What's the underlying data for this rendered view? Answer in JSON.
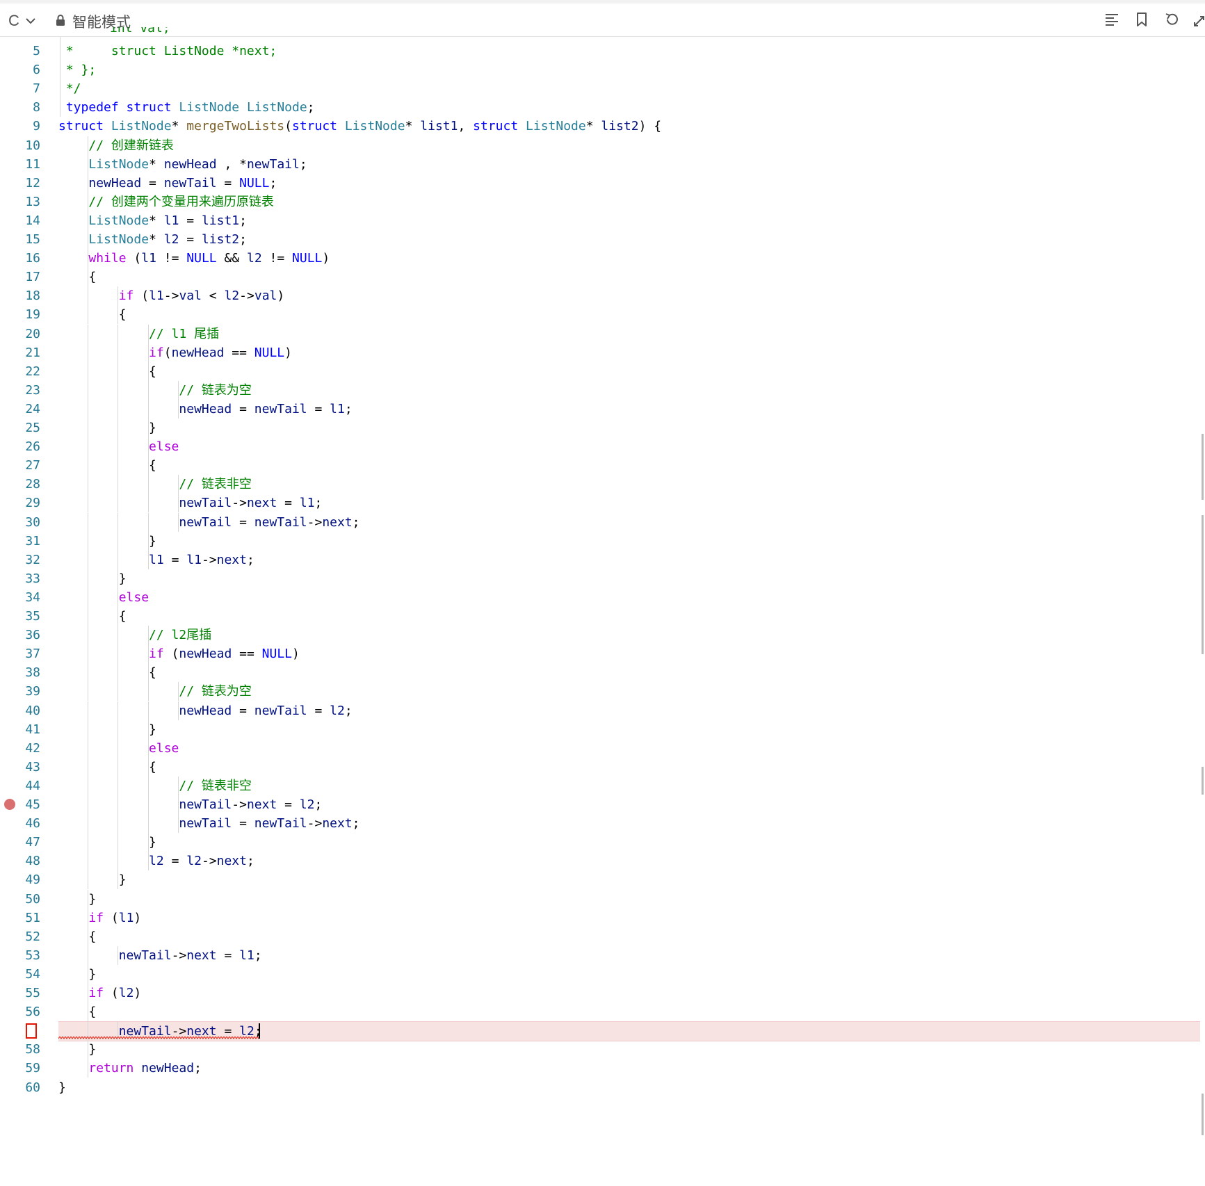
{
  "toolbar": {
    "language": "C",
    "mode": "智能模式"
  },
  "editor": {
    "partial_top_line": "int val;",
    "lines": [
      {
        "num": "5",
        "html": "<span class=\"cm\"> *     struct ListNode *next;</span>"
      },
      {
        "num": "6",
        "html": "<span class=\"cm\"> * };</span>"
      },
      {
        "num": "7",
        "html": "<span class=\"cm\"> */</span>"
      },
      {
        "num": "8",
        "html": " <span class=\"kw\">typedef</span> <span class=\"kw\">struct</span> <span class=\"tp\">ListNode</span> <span class=\"tp\">ListNode</span>;"
      },
      {
        "num": "9",
        "html": "<span class=\"kw\">struct</span> <span class=\"tp\">ListNode</span>* <span class=\"fn\">mergeTwoLists</span>(<span class=\"kw\">struct</span> <span class=\"tp\">ListNode</span>* <span class=\"vr\">list1</span>, <span class=\"kw\">struct</span> <span class=\"tp\">ListNode</span>* <span class=\"vr\">list2</span>) {"
      },
      {
        "num": "10",
        "html": "    <span class=\"cm\">// 创建新链表</span>"
      },
      {
        "num": "11",
        "html": "    <span class=\"tp\">ListNode</span>* <span class=\"vr\">newHead</span> , *<span class=\"vr\">newTail</span>;"
      },
      {
        "num": "12",
        "html": "    <span class=\"vr\">newHead</span> = <span class=\"vr\">newTail</span> = <span class=\"kw\">NULL</span>;"
      },
      {
        "num": "13",
        "html": "    <span class=\"cm\">// 创建两个变量用来遍历原链表</span>"
      },
      {
        "num": "14",
        "html": "    <span class=\"tp\">ListNode</span>* <span class=\"vr\">l1</span> = <span class=\"vr\">list1</span>;"
      },
      {
        "num": "15",
        "html": "    <span class=\"tp\">ListNode</span>* <span class=\"vr\">l2</span> = <span class=\"vr\">list2</span>;"
      },
      {
        "num": "16",
        "html": "    <span class=\"ctl\">while</span> (<span class=\"vr\">l1</span> != <span class=\"kw\">NULL</span> &amp;&amp; <span class=\"vr\">l2</span> != <span class=\"kw\">NULL</span>)"
      },
      {
        "num": "17",
        "html": "    {"
      },
      {
        "num": "18",
        "html": "        <span class=\"ctl\">if</span> (<span class=\"vr\">l1</span>-&gt;<span class=\"vr\">val</span> &lt; <span class=\"vr\">l2</span>-&gt;<span class=\"vr\">val</span>)"
      },
      {
        "num": "19",
        "html": "        {"
      },
      {
        "num": "20",
        "html": "            <span class=\"cm\">// l1 尾插</span>"
      },
      {
        "num": "21",
        "html": "            <span class=\"ctl\">if</span>(<span class=\"vr\">newHead</span> == <span class=\"kw\">NULL</span>)"
      },
      {
        "num": "22",
        "html": "            {"
      },
      {
        "num": "23",
        "html": "                <span class=\"cm\">// 链表为空</span>"
      },
      {
        "num": "24",
        "html": "                <span class=\"vr\">newHead</span> = <span class=\"vr\">newTail</span> = <span class=\"vr\">l1</span>;"
      },
      {
        "num": "25",
        "html": "            }"
      },
      {
        "num": "26",
        "html": "            <span class=\"ctl\">else</span>"
      },
      {
        "num": "27",
        "html": "            {"
      },
      {
        "num": "28",
        "html": "                <span class=\"cm\">// 链表非空</span>"
      },
      {
        "num": "29",
        "html": "                <span class=\"vr\">newTail</span>-&gt;<span class=\"vr\">next</span> = <span class=\"vr\">l1</span>;"
      },
      {
        "num": "30",
        "html": "                <span class=\"vr\">newTail</span> = <span class=\"vr\">newTail</span>-&gt;<span class=\"vr\">next</span>;"
      },
      {
        "num": "31",
        "html": "            }"
      },
      {
        "num": "32",
        "html": "            <span class=\"vr\">l1</span> = <span class=\"vr\">l1</span>-&gt;<span class=\"vr\">next</span>;"
      },
      {
        "num": "33",
        "html": "        }"
      },
      {
        "num": "34",
        "html": "        <span class=\"ctl\">else</span>"
      },
      {
        "num": "35",
        "html": "        {"
      },
      {
        "num": "36",
        "html": "            <span class=\"cm\">// l2尾插</span>"
      },
      {
        "num": "37",
        "html": "            <span class=\"ctl\">if</span> (<span class=\"vr\">newHead</span> == <span class=\"kw\">NULL</span>)"
      },
      {
        "num": "38",
        "html": "            {"
      },
      {
        "num": "39",
        "html": "                <span class=\"cm\">// 链表为空</span>"
      },
      {
        "num": "40",
        "html": "                <span class=\"vr\">newHead</span> = <span class=\"vr\">newTail</span> = <span class=\"vr\">l2</span>;"
      },
      {
        "num": "41",
        "html": "            }"
      },
      {
        "num": "42",
        "html": "            <span class=\"ctl\">else</span>"
      },
      {
        "num": "43",
        "html": "            {"
      },
      {
        "num": "44",
        "html": "                <span class=\"cm\">// 链表非空</span>"
      },
      {
        "num": "45",
        "html": "                <span class=\"vr\">newTail</span>-&gt;<span class=\"vr\">next</span> = <span class=\"vr\">l2</span>;"
      },
      {
        "num": "46",
        "html": "                <span class=\"vr\">newTail</span> = <span class=\"vr\">newTail</span>-&gt;<span class=\"vr\">next</span>;"
      },
      {
        "num": "47",
        "html": "            }"
      },
      {
        "num": "48",
        "html": "            <span class=\"vr\">l2</span> = <span class=\"vr\">l2</span>-&gt;<span class=\"vr\">next</span>;"
      },
      {
        "num": "49",
        "html": "        }"
      },
      {
        "num": "50",
        "html": "    }"
      },
      {
        "num": "51",
        "html": "    <span class=\"ctl\">if</span> (<span class=\"vr\">l1</span>)"
      },
      {
        "num": "52",
        "html": "    {"
      },
      {
        "num": "53",
        "html": "        <span class=\"vr\">newTail</span>-&gt;<span class=\"vr\">next</span> = <span class=\"vr\">l1</span>;"
      },
      {
        "num": "54",
        "html": "    }"
      },
      {
        "num": "55",
        "html": "    <span class=\"ctl\">if</span> (<span class=\"vr\">l2</span>)"
      },
      {
        "num": "56",
        "html": "    {"
      },
      {
        "num": "",
        "html": "        <span class=\"vr\">newTail</span>-&gt;<span class=\"vr\">next</span> = <span class=\"vr\">l2</span>;"
      },
      {
        "num": "58",
        "html": "    }"
      },
      {
        "num": "59",
        "html": "    <span class=\"ctl\">return</span> <span class=\"vr\">newHead</span>;"
      },
      {
        "num": "60",
        "html": "}"
      }
    ]
  },
  "colors": {
    "keyword": "#0000ff",
    "control": "#af00db",
    "comment": "#008000",
    "function": "#795e26",
    "type": "#267f99",
    "variable": "#001080",
    "line_number": "#237893",
    "breakpoint": "#d9706f",
    "error": "#e51400"
  },
  "icons": [
    "chevron-down-icon",
    "lock-icon",
    "format-icon",
    "bookmark-icon",
    "undo-icon",
    "expand-icon"
  ]
}
